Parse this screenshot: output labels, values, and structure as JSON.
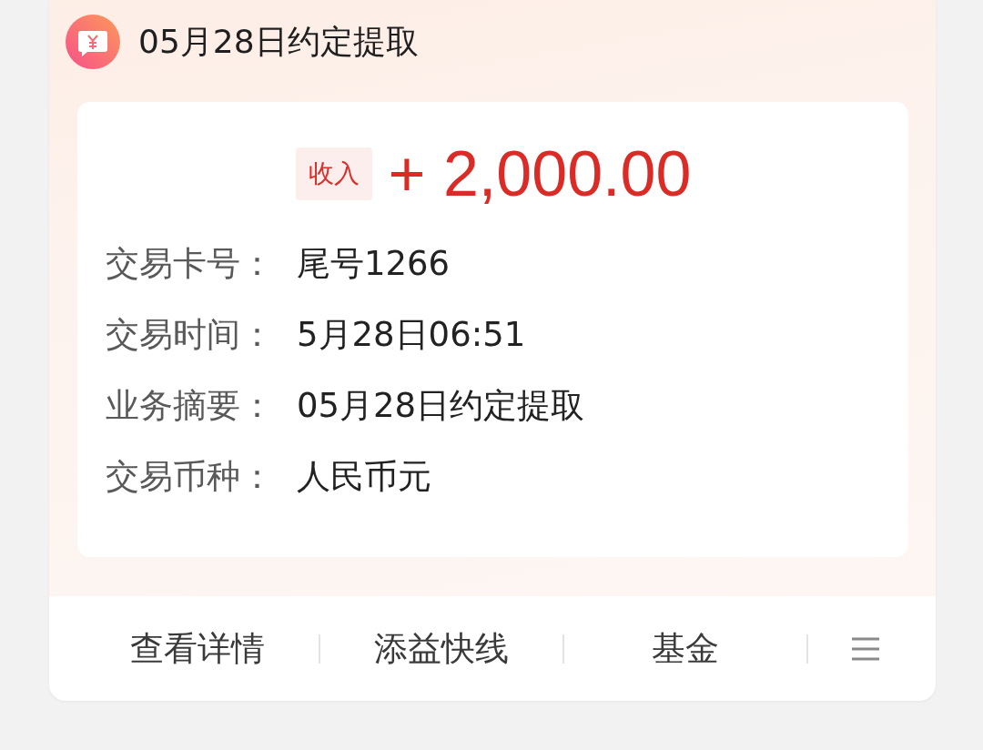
{
  "header": {
    "title": "05月28日约定提取"
  },
  "transaction": {
    "type_tag": "收入",
    "amount": "+ 2,000.00",
    "fields": [
      {
        "label": "交易卡号：",
        "value": "尾号1266"
      },
      {
        "label": "交易时间：",
        "value": "5月28日06:51"
      },
      {
        "label": "业务摘要：",
        "value": "05月28日约定提取"
      },
      {
        "label": "交易币种：",
        "value": "人民币元"
      }
    ]
  },
  "actions": [
    {
      "label": "查看详情"
    },
    {
      "label": "添益快线"
    },
    {
      "label": "基金"
    }
  ]
}
